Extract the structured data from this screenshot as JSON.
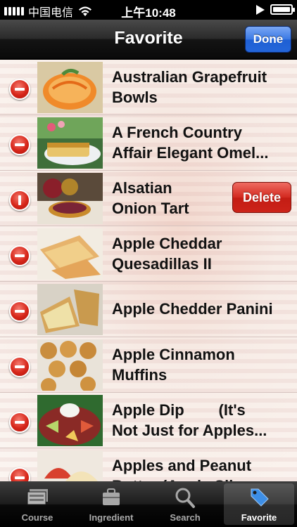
{
  "statusbar": {
    "carrier": "中国电信",
    "time": "上午10:48"
  },
  "navbar": {
    "title": "Favorite",
    "done_label": "Done"
  },
  "rows": [
    {
      "title": "Australian Grapefruit\nBowls"
    },
    {
      "title": "A French Country\nAffair Elegant Omel..."
    },
    {
      "title": "Alsatian\nOnion Tart",
      "delete_label": "Delete"
    },
    {
      "title": "Apple Cheddar\nQuesadillas II"
    },
    {
      "title": "Apple Chedder Panini"
    },
    {
      "title": "Apple Cinnamon\nMuffins"
    },
    {
      "title": "Apple Dip        (It's\nNot Just for Apples..."
    },
    {
      "title": "Apples and Peanut\nButter (Apple Slices..."
    }
  ],
  "tabs": [
    {
      "label": "Course",
      "icon": "course-icon"
    },
    {
      "label": "Ingredient",
      "icon": "ingredient-icon"
    },
    {
      "label": "Search",
      "icon": "search-icon"
    },
    {
      "label": "Favorite",
      "icon": "tag-icon",
      "active": true
    }
  ]
}
